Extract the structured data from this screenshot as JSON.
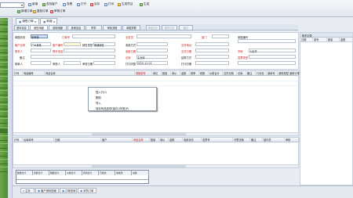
{
  "toolbar": {
    "combo_value": "",
    "row1": [
      "新增",
      "查找客户",
      "查看",
      "打开",
      "另存",
      "打印",
      "生成凭证",
      "生成"
    ],
    "row2": [
      "新增订单",
      "复制订单",
      "审核订单"
    ]
  },
  "tabs": {
    "doc_tabs": [
      "销售订单",
      "新增"
    ],
    "sub_tabs": [
      "基本信息",
      "销售明细",
      "费用明细",
      "其他信息",
      "附件",
      "审批流程",
      "单据关联",
      "审批意见",
      "操作日志",
      "备注"
    ]
  },
  "form": {
    "labels": {
      "r1": [
        "单据状态",
        "订单号",
        "业务员",
        "部门",
        "单据编号"
      ],
      "r2": [
        "客户名称",
        "客户编号",
        "销售类型",
        "收款方式",
        "交货地址"
      ],
      "r3": [
        "联系人",
        "联系电话",
        "收款日期",
        "交货日期",
        "币种"
      ],
      "r4": [
        "备注",
        "仓库",
        "结算方式",
        "发票类型"
      ],
      "r5": [
        "制单人",
        "审核人",
        "审核日期",
        "打印次数",
        "打印日期"
      ]
    },
    "values": {
      "status": "未审核",
      "order_no": "PO2020",
      "customer": "广州某某",
      "date1": "2020-12-01",
      "currency": "人民币",
      "warehouse": "主仓库",
      "maker": "系统管理员",
      "sale_mode": "普通销售",
      "settle": "现金",
      "tax": "增值税"
    }
  },
  "grid": {
    "headers": [
      "行号",
      "商品编号",
      "商品名称",
      "规格型号",
      "单位",
      "数量",
      "单价",
      "金额",
      "税率",
      "税额",
      "价税合计",
      "交货日期",
      "仓库",
      "备注",
      "行状态",
      "源单号",
      "源单类型",
      "源单行号"
    ]
  },
  "context_menu": {
    "items": [
      "插入行(I)",
      "删除",
      "导入",
      "保存商品选项(保存)/列宽(P)"
    ]
  },
  "grid2": {
    "headers": [
      "行号",
      "出库单号",
      "日期",
      "客户",
      "商品名称",
      "数量",
      "单价",
      "金额",
      "收款状态",
      "发票号",
      "开票日期",
      "备注",
      "操作员",
      "审核"
    ]
  },
  "summary": {
    "cols": [
      "数量合计",
      "金额合计",
      "税额合计",
      "价税合计",
      "折扣合计",
      "已收款",
      "未收款",
      "余额"
    ]
  },
  "status_tabs": [
    "主页",
    "客户资料档案",
    "订单查询",
    "采购订单"
  ],
  "right_panel": {
    "title": "相关记录",
    "headers": [
      "日期",
      "单号",
      "数量",
      "金额"
    ]
  },
  "colors": {
    "sidebar_green": "#4e8c32",
    "required_red": "#d11e1e",
    "blue_label": "#1d3fa8"
  }
}
